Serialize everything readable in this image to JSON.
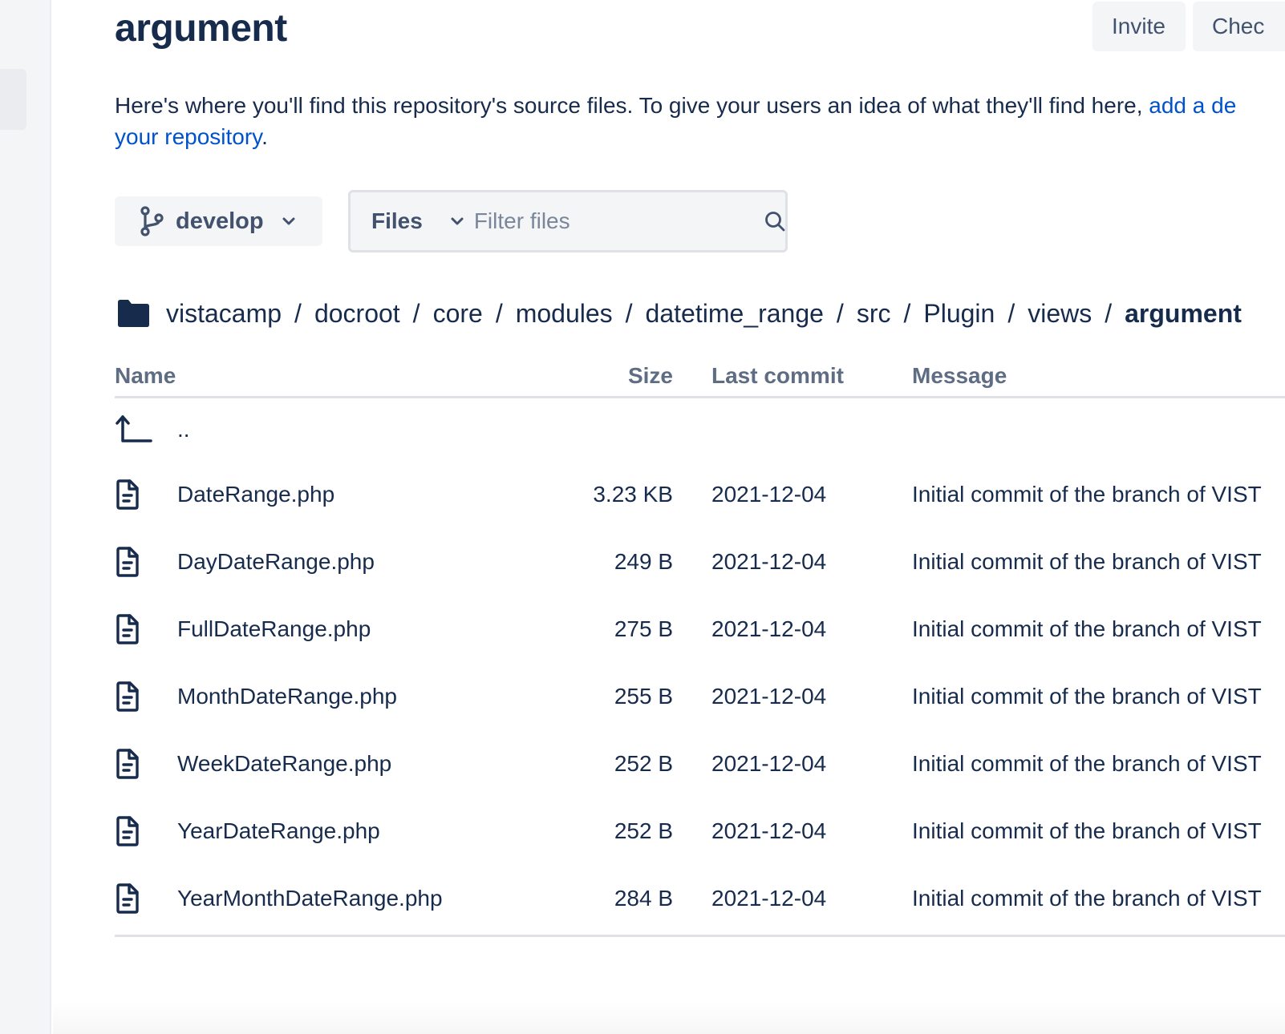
{
  "header": {
    "title": "argument",
    "invite_label": "Invite",
    "check_label": "Chec"
  },
  "description": {
    "text": "Here's where you'll find this repository's source files. To give your users an idea of what they'll find here, ",
    "link1": "add a de",
    "link2": "your repository",
    "end": "."
  },
  "toolbar": {
    "branch": "develop",
    "filter_type": "Files",
    "filter_placeholder": "Filter files"
  },
  "breadcrumb": {
    "segments": [
      "vistacamp",
      "docroot",
      "core",
      "modules",
      "datetime_range",
      "src",
      "Plugin",
      "views"
    ],
    "current": "argument",
    "separator": "/"
  },
  "table": {
    "columns": {
      "name": "Name",
      "size": "Size",
      "last_commit": "Last commit",
      "message": "Message"
    },
    "parent_label": "..",
    "rows": [
      {
        "name": "DateRange.php",
        "size": "3.23 KB",
        "date": "2021-12-04",
        "message": "Initial commit of the branch of VIST"
      },
      {
        "name": "DayDateRange.php",
        "size": "249 B",
        "date": "2021-12-04",
        "message": "Initial commit of the branch of VIST"
      },
      {
        "name": "FullDateRange.php",
        "size": "275 B",
        "date": "2021-12-04",
        "message": "Initial commit of the branch of VIST"
      },
      {
        "name": "MonthDateRange.php",
        "size": "255 B",
        "date": "2021-12-04",
        "message": "Initial commit of the branch of VIST"
      },
      {
        "name": "WeekDateRange.php",
        "size": "252 B",
        "date": "2021-12-04",
        "message": "Initial commit of the branch of VIST"
      },
      {
        "name": "YearDateRange.php",
        "size": "252 B",
        "date": "2021-12-04",
        "message": "Initial commit of the branch of VIST"
      },
      {
        "name": "YearMonthDateRange.php",
        "size": "284 B",
        "date": "2021-12-04",
        "message": "Initial commit of the branch of VIST"
      }
    ]
  },
  "icons": {
    "branch": "branch-icon",
    "chevron": "chevron-down-icon",
    "search": "search-icon",
    "folder": "folder-icon",
    "parent": "parent-directory-icon",
    "file": "file-icon"
  },
  "colors": {
    "text": "#172b4d",
    "muted": "#5e6c84",
    "link": "#0052cc",
    "button_bg": "#f4f5f7",
    "border": "#dfe1e6"
  }
}
